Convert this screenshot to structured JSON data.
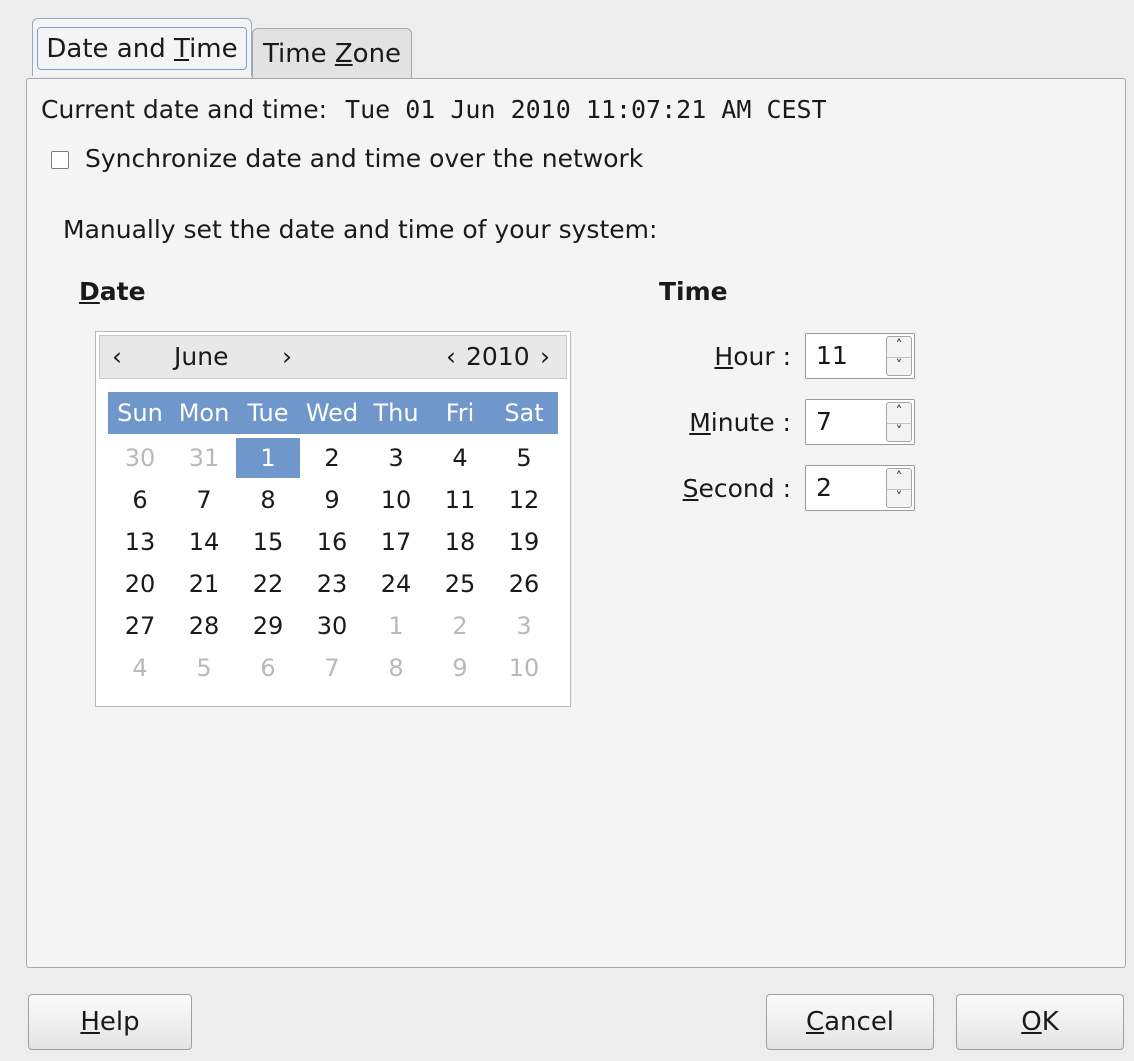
{
  "tabs": [
    {
      "label_pre": "Date and ",
      "label_mn": "T",
      "label_post": "ime"
    },
    {
      "label_pre": "Time ",
      "label_mn": "Z",
      "label_post": "one"
    }
  ],
  "current": {
    "label": "Current date and time:",
    "value": "Tue 01 Jun 2010 11:07:21 AM CEST"
  },
  "sync_label": "Synchronize date and time over the network",
  "manual_label": "Manually set the date and time of your system:",
  "date_heading_mn": "D",
  "date_heading_rest": "ate",
  "time_heading": "Time",
  "calendar": {
    "prev_month": "‹",
    "month": "June",
    "next_month": "›",
    "prev_year": "‹",
    "year": "2010",
    "next_year": "›",
    "weekdays": [
      "Sun",
      "Mon",
      "Tue",
      "Wed",
      "Thu",
      "Fri",
      "Sat"
    ],
    "weeks": [
      [
        "30",
        "31",
        "1",
        "2",
        "3",
        "4",
        "5"
      ],
      [
        "6",
        "7",
        "8",
        "9",
        "10",
        "11",
        "12"
      ],
      [
        "13",
        "14",
        "15",
        "16",
        "17",
        "18",
        "19"
      ],
      [
        "20",
        "21",
        "22",
        "23",
        "24",
        "25",
        "26"
      ],
      [
        "27",
        "28",
        "29",
        "30",
        "1",
        "2",
        "3"
      ],
      [
        "4",
        "5",
        "6",
        "7",
        "8",
        "9",
        "10"
      ]
    ],
    "other_month": [
      [
        true,
        true,
        false,
        false,
        false,
        false,
        false
      ],
      [
        false,
        false,
        false,
        false,
        false,
        false,
        false
      ],
      [
        false,
        false,
        false,
        false,
        false,
        false,
        false
      ],
      [
        false,
        false,
        false,
        false,
        false,
        false,
        false
      ],
      [
        false,
        false,
        false,
        false,
        true,
        true,
        true
      ],
      [
        true,
        true,
        true,
        true,
        true,
        true,
        true
      ]
    ],
    "selected": "1"
  },
  "time": {
    "hour": {
      "label_mn": "H",
      "label_rest": "our :",
      "value": "11"
    },
    "minute": {
      "label_mn": "M",
      "label_rest": "inute :",
      "value": "7"
    },
    "second": {
      "label_mn": "S",
      "label_rest": "econd :",
      "value": "2"
    }
  },
  "buttons": {
    "help": {
      "mn": "H",
      "rest": "elp"
    },
    "cancel": {
      "mn": "C",
      "rest": "ancel"
    },
    "ok": {
      "mn": "O",
      "rest": "K"
    }
  },
  "colors": {
    "accent": "#6f97cc",
    "other_month_text": "#b9b9b9"
  }
}
